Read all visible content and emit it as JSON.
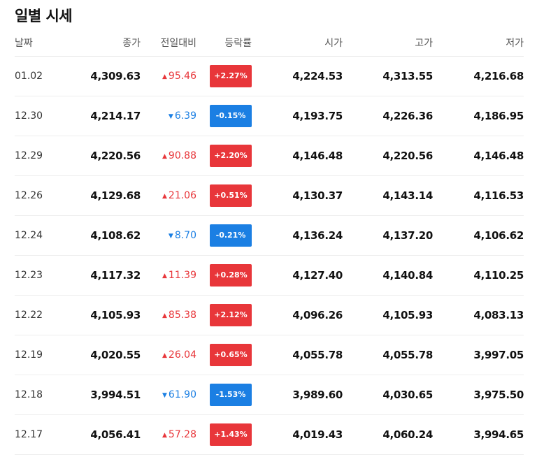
{
  "title": "일별 시세",
  "colors": {
    "up": "#e8363a",
    "down": "#1b7fe3"
  },
  "headers": {
    "date": "날짜",
    "close": "종가",
    "diff": "전일대비",
    "rate": "등락률",
    "open": "시가",
    "high": "고가",
    "low": "저가"
  },
  "rows": [
    {
      "date": "01.02",
      "close": "4,309.63",
      "direction": "up",
      "diff": "95.46",
      "rate": "+2.27%",
      "open": "4,224.53",
      "high": "4,313.55",
      "low": "4,216.68"
    },
    {
      "date": "12.30",
      "close": "4,214.17",
      "direction": "down",
      "diff": "6.39",
      "rate": "-0.15%",
      "open": "4,193.75",
      "high": "4,226.36",
      "low": "4,186.95"
    },
    {
      "date": "12.29",
      "close": "4,220.56",
      "direction": "up",
      "diff": "90.88",
      "rate": "+2.20%",
      "open": "4,146.48",
      "high": "4,220.56",
      "low": "4,146.48"
    },
    {
      "date": "12.26",
      "close": "4,129.68",
      "direction": "up",
      "diff": "21.06",
      "rate": "+0.51%",
      "open": "4,130.37",
      "high": "4,143.14",
      "low": "4,116.53"
    },
    {
      "date": "12.24",
      "close": "4,108.62",
      "direction": "down",
      "diff": "8.70",
      "rate": "-0.21%",
      "open": "4,136.24",
      "high": "4,137.20",
      "low": "4,106.62"
    },
    {
      "date": "12.23",
      "close": "4,117.32",
      "direction": "up",
      "diff": "11.39",
      "rate": "+0.28%",
      "open": "4,127.40",
      "high": "4,140.84",
      "low": "4,110.25"
    },
    {
      "date": "12.22",
      "close": "4,105.93",
      "direction": "up",
      "diff": "85.38",
      "rate": "+2.12%",
      "open": "4,096.26",
      "high": "4,105.93",
      "low": "4,083.13"
    },
    {
      "date": "12.19",
      "close": "4,020.55",
      "direction": "up",
      "diff": "26.04",
      "rate": "+0.65%",
      "open": "4,055.78",
      "high": "4,055.78",
      "low": "3,997.05"
    },
    {
      "date": "12.18",
      "close": "3,994.51",
      "direction": "down",
      "diff": "61.90",
      "rate": "-1.53%",
      "open": "3,989.60",
      "high": "4,030.65",
      "low": "3,975.50"
    },
    {
      "date": "12.17",
      "close": "4,056.41",
      "direction": "up",
      "diff": "57.28",
      "rate": "+1.43%",
      "open": "4,019.43",
      "high": "4,060.24",
      "low": "3,994.65"
    }
  ]
}
